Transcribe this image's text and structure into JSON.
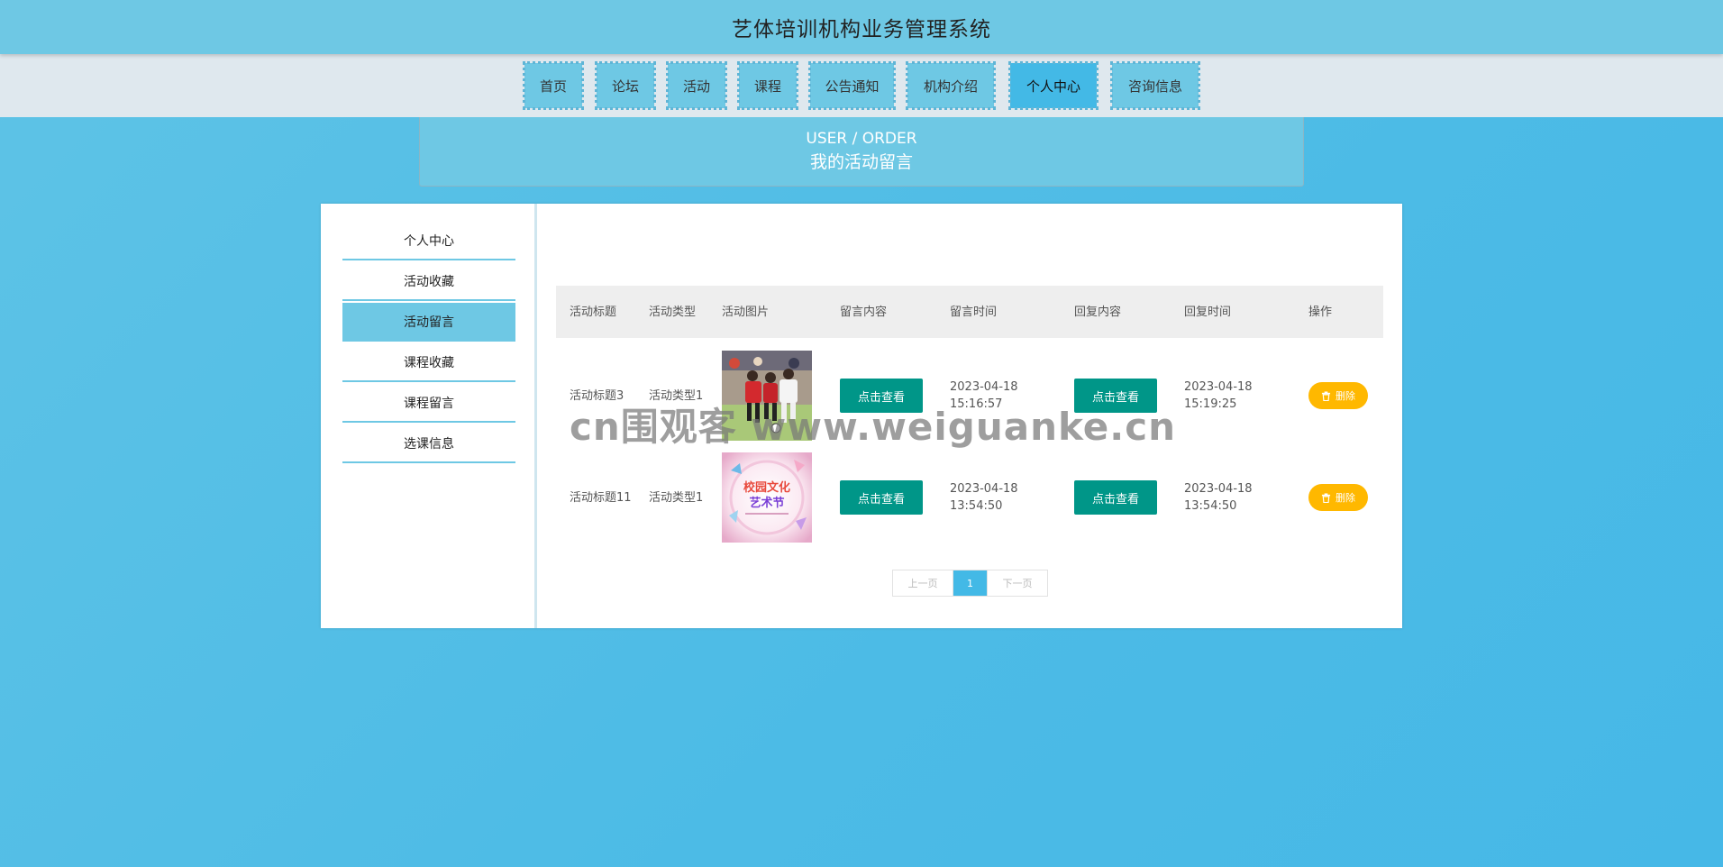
{
  "header": {
    "title": "艺体培训机构业务管理系统"
  },
  "nav": {
    "items": [
      {
        "label": "首页"
      },
      {
        "label": "论坛"
      },
      {
        "label": "活动"
      },
      {
        "label": "课程"
      },
      {
        "label": "公告通知"
      },
      {
        "label": "机构介绍"
      },
      {
        "label": "个人中心",
        "active": true
      },
      {
        "label": "咨询信息"
      }
    ]
  },
  "banner": {
    "subtitle_en": "USER / ORDER",
    "title": "我的活动留言"
  },
  "sidebar": {
    "items": [
      {
        "label": "个人中心"
      },
      {
        "label": "活动收藏"
      },
      {
        "label": "活动留言",
        "active": true
      },
      {
        "label": "课程收藏"
      },
      {
        "label": "课程留言"
      },
      {
        "label": "选课信息"
      }
    ]
  },
  "table": {
    "columns": [
      "活动标题",
      "活动类型",
      "活动图片",
      "留言内容",
      "留言时间",
      "回复内容",
      "回复时间",
      "操作"
    ],
    "rows": [
      {
        "title": "活动标题3",
        "type": "活动类型1",
        "image_icon": "children-soccer-photo",
        "content_button": "点击查看",
        "message_time": "2023-04-18 15:16:57",
        "reply_button": "点击查看",
        "reply_time": "2023-04-18 15:19:25",
        "delete_label": "删除"
      },
      {
        "title": "活动标题11",
        "type": "活动类型1",
        "image_icon": "campus-art-festival-poster",
        "image_text": "校园文化艺术节",
        "content_button": "点击查看",
        "message_time": "2023-04-18 13:54:50",
        "reply_button": "点击查看",
        "reply_time": "2023-04-18 13:54:50",
        "delete_label": "删除"
      }
    ]
  },
  "pagination": {
    "prev": "上一页",
    "current": "1",
    "next": "下一页"
  },
  "watermark": "cn围观客 www.weiguanke.cn",
  "colors": {
    "background": "#4cbbe6",
    "header": "#6ec8e4",
    "nav_active": "#43b9e6",
    "button_view": "#009688",
    "button_delete": "#ffb800"
  }
}
